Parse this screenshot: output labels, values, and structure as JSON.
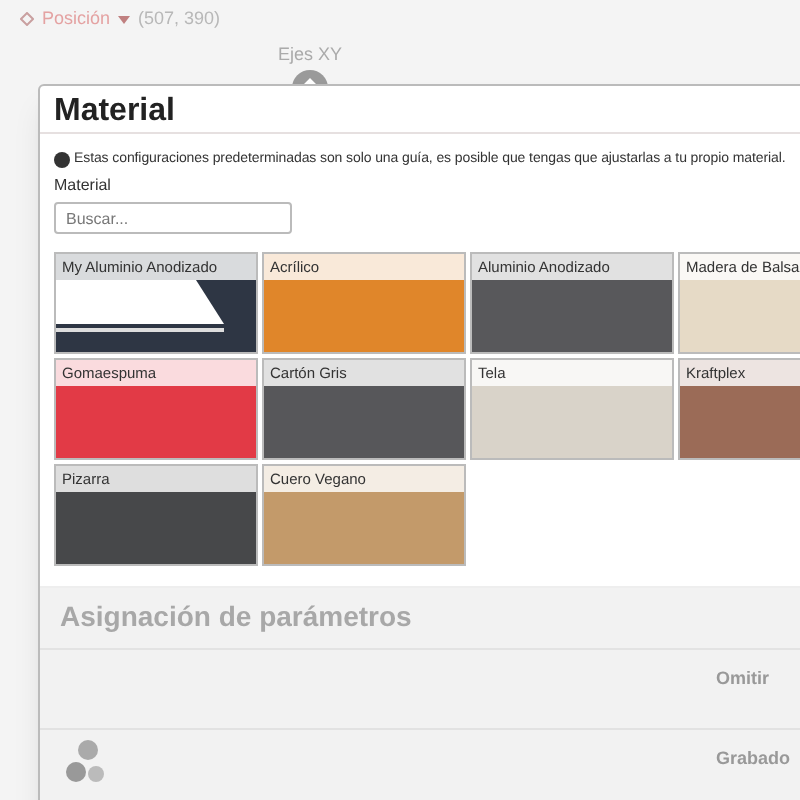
{
  "toolbar": {
    "position_label": "Posición",
    "position_value": "(507, 390)",
    "axes_label": "Ejes XY"
  },
  "dialog": {
    "title": "Material",
    "info": "Estas configuraciones predeterminadas son solo una guía, es posible que tengas que ajustarlas a tu propio material.",
    "field_label": "Material",
    "search": {
      "placeholder": "Buscar..."
    },
    "materials": [
      {
        "name": "My Aluminio Anodizado",
        "kind": "custom",
        "color": "#2e3644"
      },
      {
        "name": "Acrílico",
        "kind": "preset",
        "color": "#e0862a"
      },
      {
        "name": "Aluminio Anodizado",
        "kind": "preset",
        "color": "#58585b"
      },
      {
        "name": "Madera de Balsa",
        "kind": "preset",
        "color": "#e6dac6"
      },
      {
        "name": "Gomaespuma",
        "kind": "preset",
        "color": "#e23a46"
      },
      {
        "name": "Cartón Gris",
        "kind": "preset",
        "color": "#57575a"
      },
      {
        "name": "Tela",
        "kind": "preset",
        "color": "#d9d3c9"
      },
      {
        "name": "Kraftplex",
        "kind": "preset",
        "color": "#9b6b57"
      },
      {
        "name": "Pizarra",
        "kind": "preset",
        "color": "#47484a"
      },
      {
        "name": "Cuero Vegano",
        "kind": "preset",
        "color": "#c39a6a"
      }
    ],
    "section_title": "Asignación de parámetros",
    "options": [
      "Omitir",
      "Grabado"
    ]
  }
}
